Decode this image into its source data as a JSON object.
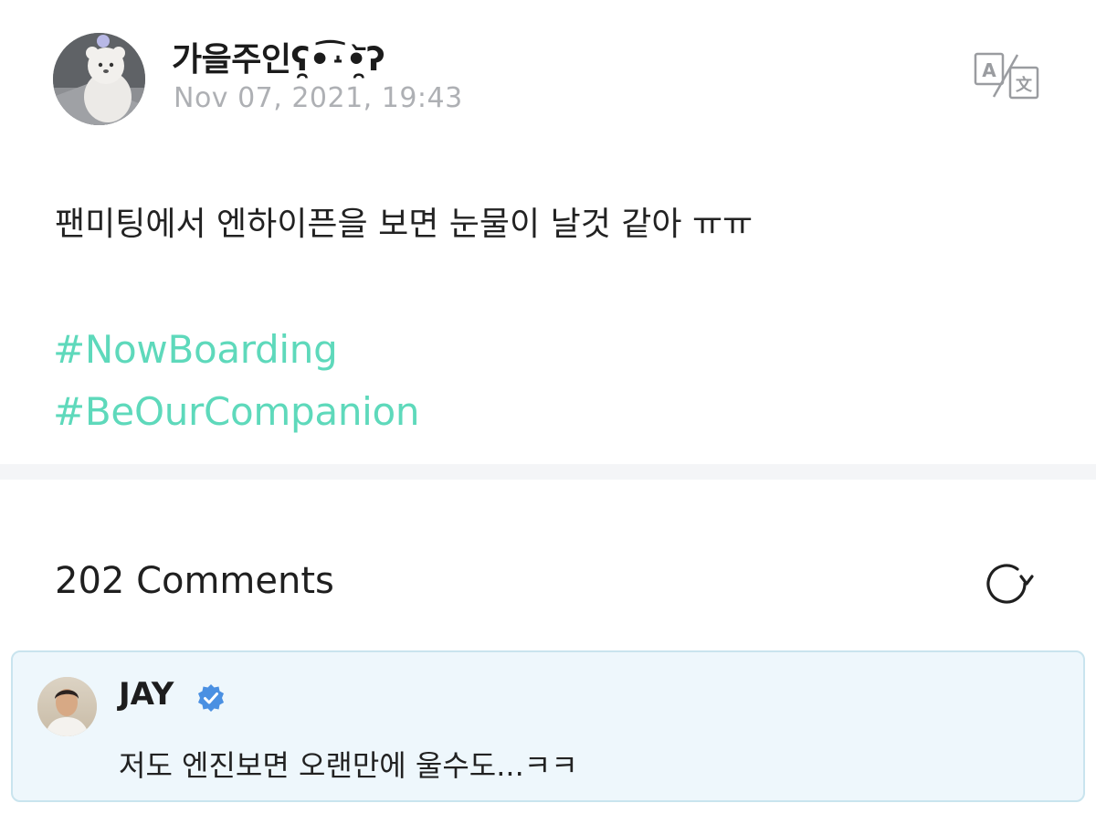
{
  "post": {
    "author_name": "가을주인ʕ̯•͡˔•̯᷅ʔ",
    "date": "Nov 07, 2021, 19:43",
    "body": "팬미팅에서 엔하이픈을 보면 눈물이 날것 같아 ㅠㅠ",
    "hashtags": [
      "#NowBoarding",
      "#BeOurCompanion"
    ],
    "avatar_icon": "white-teddy-bear-avatar",
    "translate_icon": "translate-icon"
  },
  "comments": {
    "title": "202 Comments",
    "refresh_icon": "refresh-icon",
    "items": [
      {
        "author": "JAY",
        "verified": true,
        "text": "저도 엔진보면 오랜만에 울수도...ㅋㅋ",
        "avatar_icon": "profile-photo-avatar"
      }
    ]
  },
  "colors": {
    "hashtag": "#5ed9bb",
    "date": "#aeb0b4",
    "verified": "#4a90e2",
    "comment_bg": "#eef7fc",
    "comment_border": "#c9e4ee",
    "divider": "#f4f5f7"
  }
}
